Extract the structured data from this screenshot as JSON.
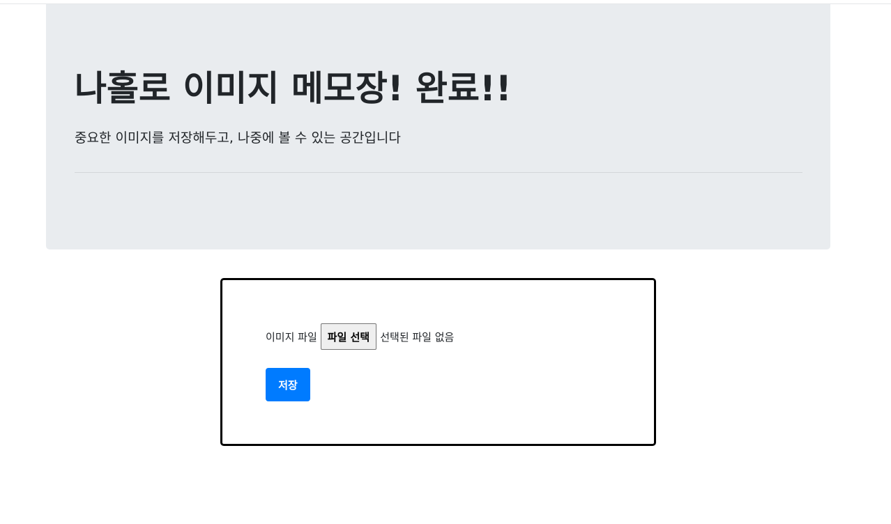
{
  "header": {
    "title": "나홀로 이미지 메모장! 완료!!",
    "lead": "중요한 이미지를 저장해두고, 나중에 볼 수 있는 공간입니다"
  },
  "form": {
    "file_label": "이미지 파일",
    "file_button_label": "파일 선택",
    "file_status": "선택된 파일 없음",
    "save_label": "저장"
  },
  "colors": {
    "jumbotron_bg": "#e9ecef",
    "primary": "#007bff",
    "card_border": "#000000"
  }
}
